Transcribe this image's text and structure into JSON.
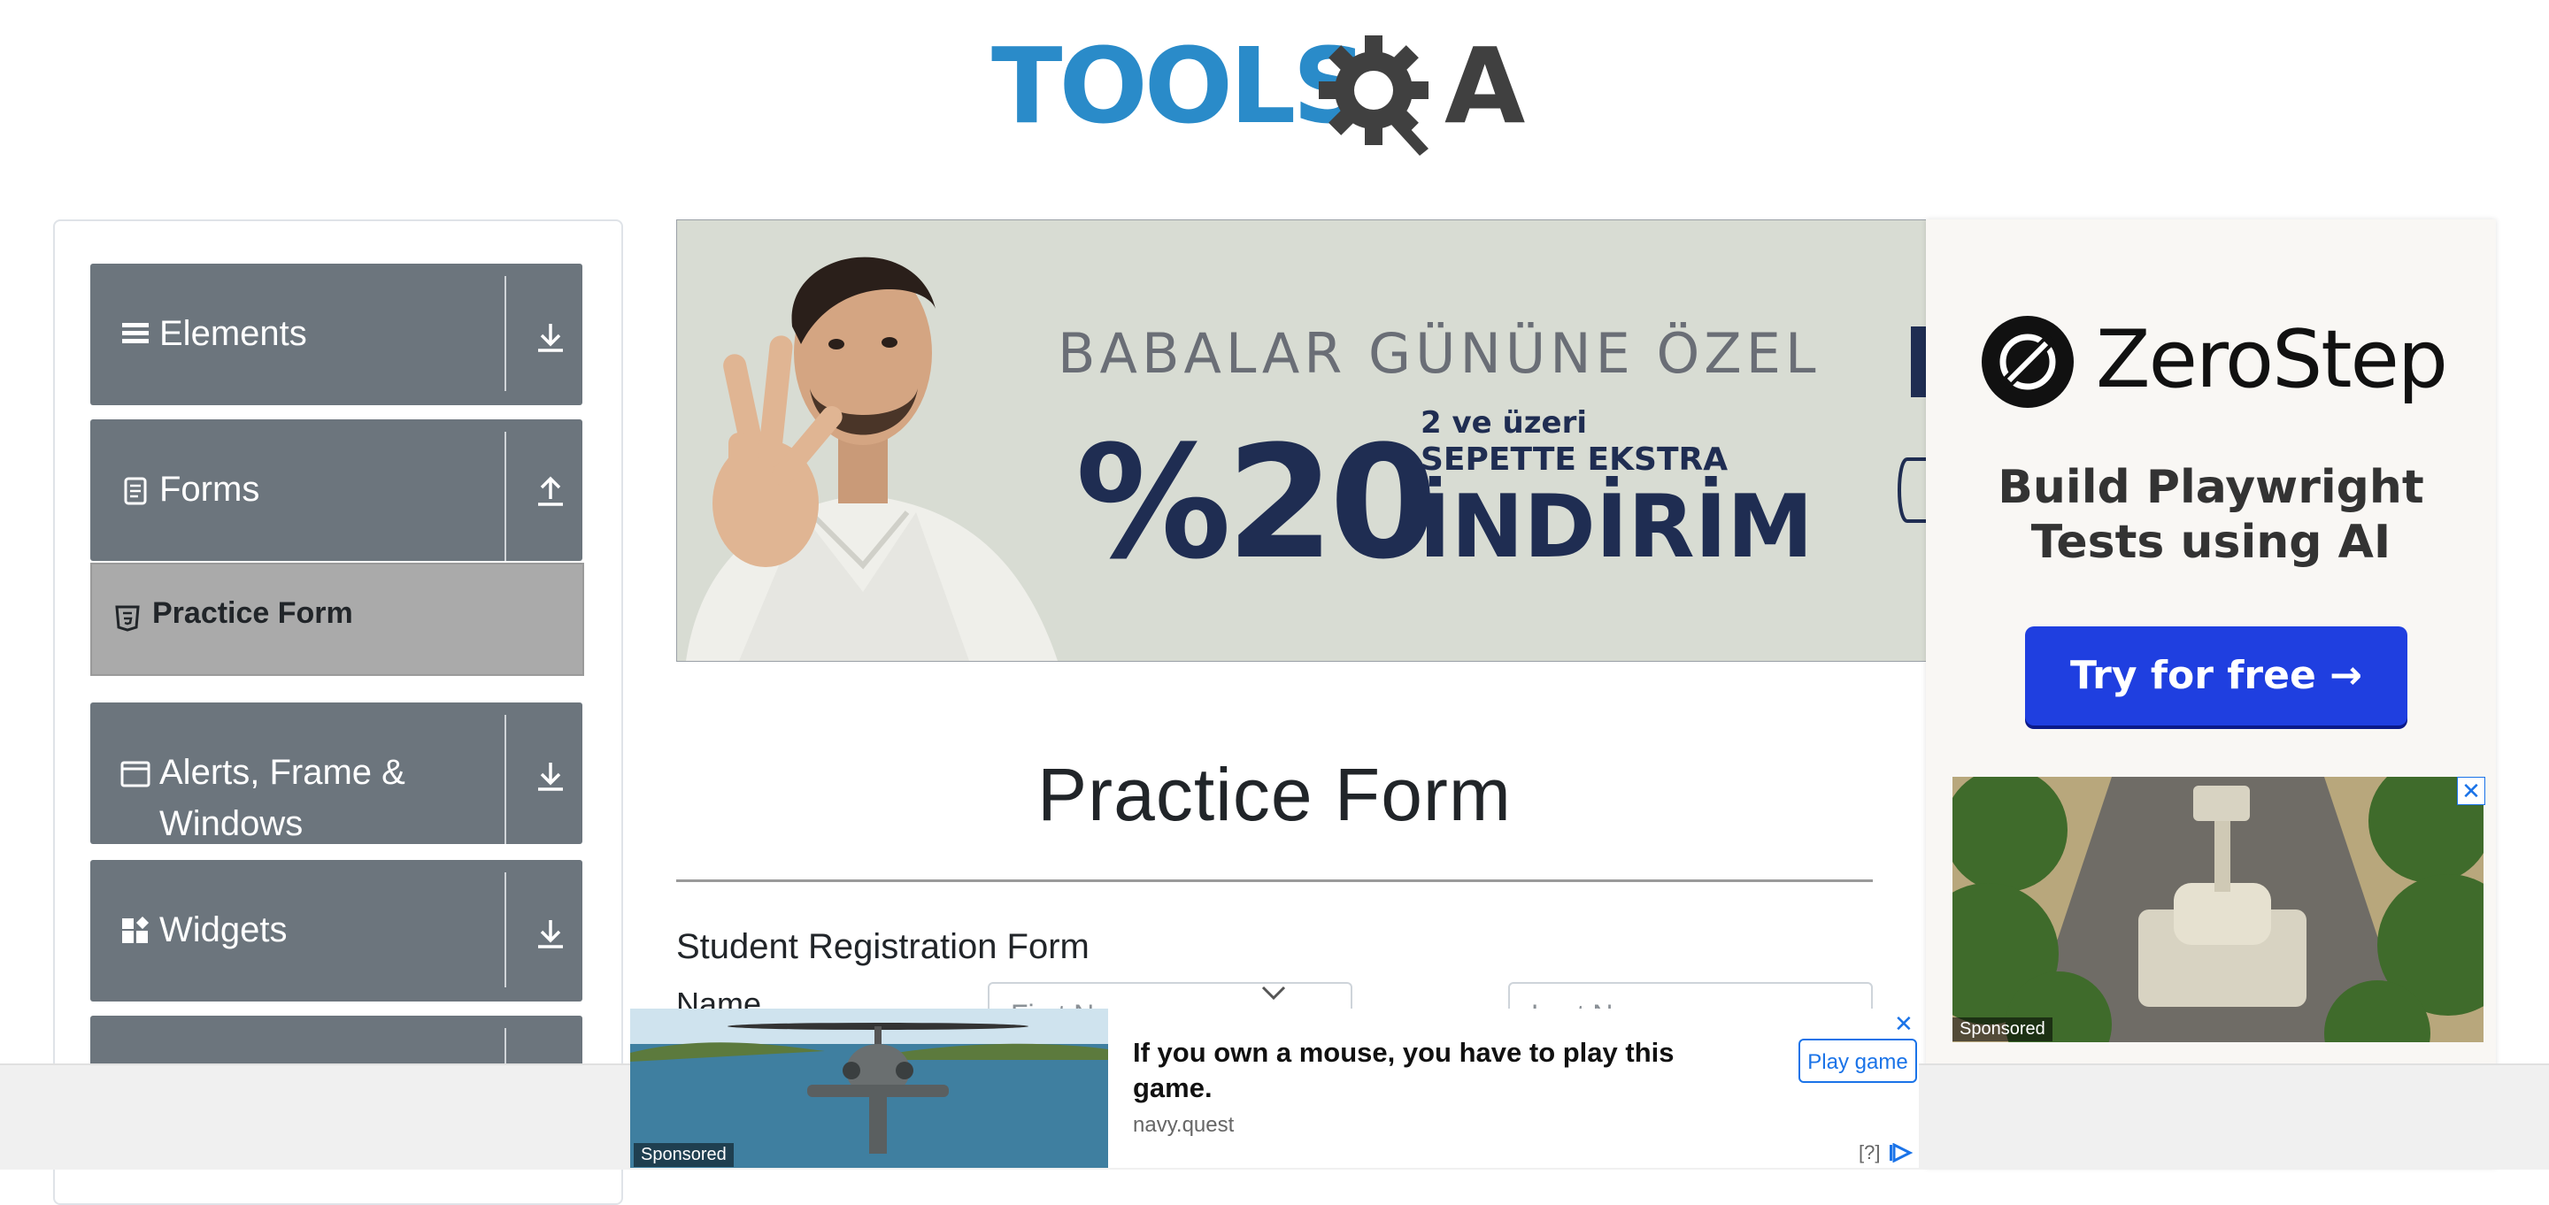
{
  "logo": {
    "part1": "TOOLS",
    "part2": "A"
  },
  "sidebar": {
    "groups": [
      {
        "label": "Elements",
        "icon": "hamburger-icon",
        "arrow": "download-arrow-icon"
      },
      {
        "label": "Forms",
        "icon": "document-icon",
        "arrow": "upload-arrow-icon"
      },
      {
        "label": "Alerts, Frame & Windows",
        "icon": "window-icon",
        "arrow": "download-arrow-icon"
      },
      {
        "label": "Widgets",
        "icon": "widgets-icon",
        "arrow": "download-arrow-icon"
      }
    ],
    "active_item": {
      "label": "Practice Form",
      "icon": "html5-icon"
    }
  },
  "banner": {
    "line1": "BABALAR GÜNÜNE ÖZEL",
    "big": "%20",
    "small1": "2 ve üzeri",
    "small2": "SEPETTE EKSTRA",
    "small3": "İNDİRİM"
  },
  "right_ad": {
    "brand": "ZeroStep",
    "headline": "Build Playwright Tests using AI",
    "cta": "Try for free →",
    "sponsored": "Sponsored",
    "close": "✕"
  },
  "main": {
    "page_title": "Practice Form",
    "form_title": "Student Registration Form",
    "name_label": "Name",
    "first_name_placeholder": "First Name",
    "last_name_placeholder": "Last Name"
  },
  "bottom_ad": {
    "headline": "If you own a mouse, you have to play this game.",
    "source": "navy.quest",
    "cta": "Play game",
    "sponsored": "Sponsored",
    "info": "[?]",
    "close": "✕"
  },
  "colors": {
    "sidebar_group": "#6c757d",
    "sidebar_active": "#aaaaaa",
    "logo_blue": "#2a8bc9",
    "logo_dark": "#404040",
    "banner_navy": "#1f2d52",
    "cta_blue": "#1f3fe0"
  }
}
